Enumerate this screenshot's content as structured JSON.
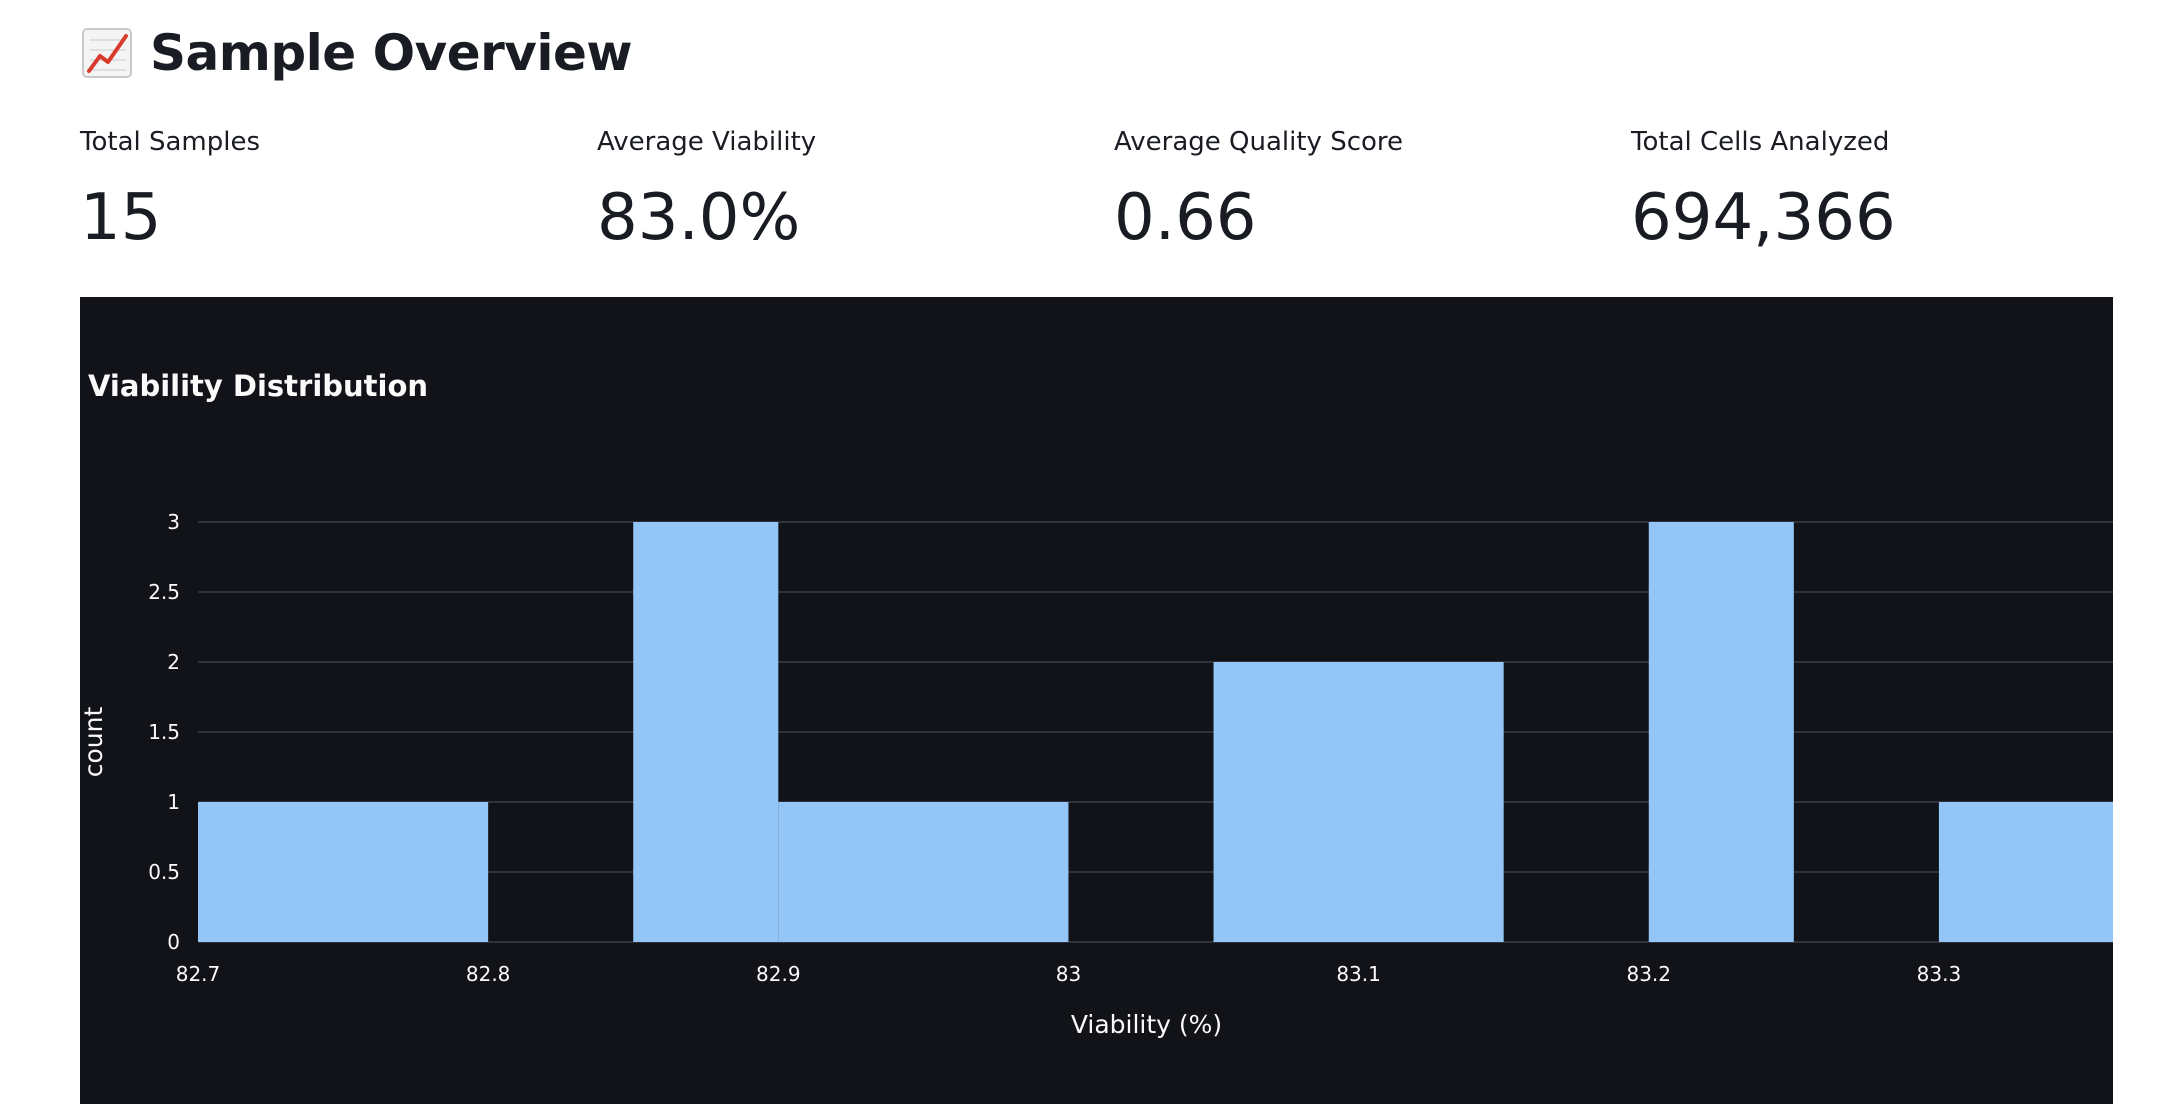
{
  "page": {
    "title": "Sample Overview",
    "title_icon": "chart-increasing-icon"
  },
  "metrics": [
    {
      "label": "Total Samples",
      "value": "15"
    },
    {
      "label": "Average Viability",
      "value": "83.0%"
    },
    {
      "label": "Average Quality Score",
      "value": "0.66"
    },
    {
      "label": "Total Cells Analyzed",
      "value": "694,366"
    }
  ],
  "chart_data": {
    "type": "bar",
    "title": "Viability Distribution",
    "xlabel": "Viability (%)",
    "ylabel": "count",
    "xlim": [
      82.7,
      83.36
    ],
    "ylim": [
      0,
      3
    ],
    "x_ticks": [
      "82.7",
      "82.8",
      "82.9",
      "83",
      "83.1",
      "83.2",
      "83.3"
    ],
    "y_ticks": [
      "0",
      "0.5",
      "1",
      "1.5",
      "2",
      "2.5",
      "3"
    ],
    "bins": [
      {
        "start": 82.7,
        "end": 82.8,
        "count": 1
      },
      {
        "start": 82.85,
        "end": 82.9,
        "count": 3
      },
      {
        "start": 82.9,
        "end": 83.0,
        "count": 1
      },
      {
        "start": 83.05,
        "end": 83.15,
        "count": 2
      },
      {
        "start": 83.2,
        "end": 83.25,
        "count": 3
      },
      {
        "start": 83.3,
        "end": 83.36,
        "count": 1
      }
    ],
    "grid": true,
    "bar_color": "#93c6f6",
    "background_color": "#111318",
    "grid_color": "#3a3d45"
  }
}
